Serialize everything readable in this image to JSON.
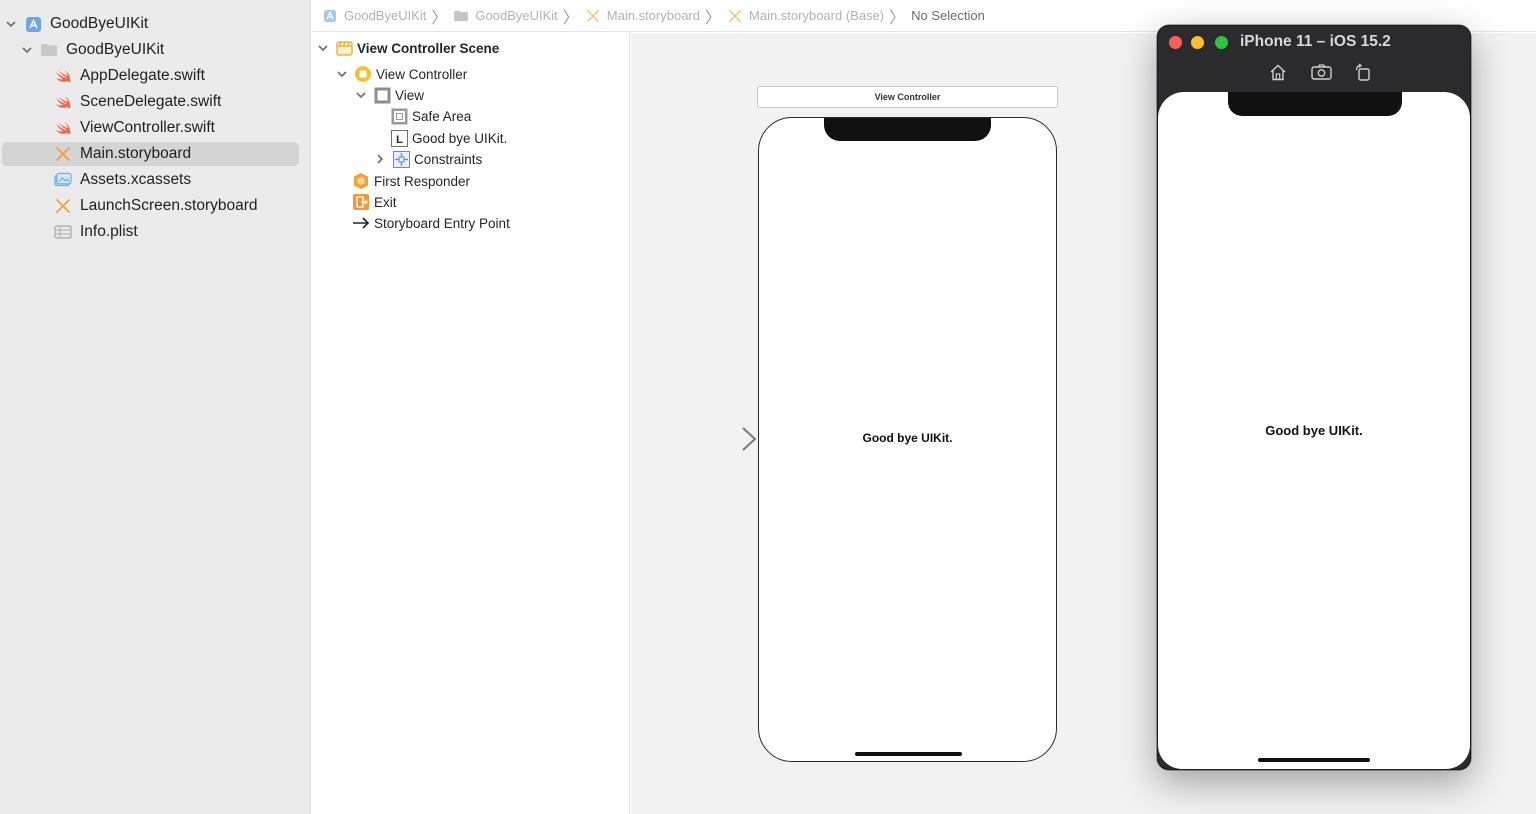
{
  "navigator": {
    "items": [
      {
        "label": "GoodByeUIKit",
        "icon": "xcode-project-icon",
        "expanded": true
      },
      {
        "label": "GoodByeUIKit",
        "icon": "folder-icon",
        "expanded": true
      },
      {
        "label": "AppDelegate.swift",
        "icon": "swift-file-icon"
      },
      {
        "label": "SceneDelegate.swift",
        "icon": "swift-file-icon"
      },
      {
        "label": "ViewController.swift",
        "icon": "swift-file-icon"
      },
      {
        "label": "Main.storyboard",
        "icon": "storyboard-file-icon",
        "selected": true
      },
      {
        "label": "Assets.xcassets",
        "icon": "asset-catalog-icon"
      },
      {
        "label": "LaunchScreen.storyboard",
        "icon": "storyboard-file-icon"
      },
      {
        "label": "Info.plist",
        "icon": "plist-file-icon"
      }
    ]
  },
  "jumpbar": {
    "crumbs": [
      {
        "label": "GoodByeUIKit",
        "icon": "xcode-project-icon"
      },
      {
        "label": "GoodByeUIKit",
        "icon": "folder-icon"
      },
      {
        "label": "Main.storyboard",
        "icon": "storyboard-file-icon"
      },
      {
        "label": "Main.storyboard (Base)",
        "icon": "storyboard-file-icon"
      },
      {
        "label": "No Selection",
        "icon": ""
      }
    ]
  },
  "outline": {
    "items": [
      {
        "label": "View Controller Scene",
        "icon": "scene-icon"
      },
      {
        "label": "View Controller",
        "icon": "view-controller-icon"
      },
      {
        "label": "View",
        "icon": "view-icon"
      },
      {
        "label": "Safe Area",
        "icon": "safe-area-icon"
      },
      {
        "label": "Good bye UIKit.",
        "icon": "label-icon",
        "glyph": "L"
      },
      {
        "label": "Constraints",
        "icon": "constraints-icon"
      },
      {
        "label": "First Responder",
        "icon": "first-responder-icon"
      },
      {
        "label": "Exit",
        "icon": "exit-icon"
      },
      {
        "label": "Storyboard Entry Point",
        "icon": "entry-point-arrow-icon"
      }
    ]
  },
  "canvas": {
    "scene_title": "View Controller",
    "label_text": "Good bye UIKit."
  },
  "simulator": {
    "title": "iPhone 11 – iOS 15.2",
    "tools": [
      "home-icon",
      "screenshot-icon",
      "rotate-icon"
    ],
    "label_text": "Good bye UIKit."
  },
  "colors": {
    "navigator_bg": "#ebebeb",
    "selection_bg": "#d4d4d4",
    "canvas_bg": "#f2f2f2",
    "storyboard_accent": "#f0a23a",
    "swift_accent": "#f05138",
    "simulator_chrome": "#2b2b2d",
    "traffic_red": "#fe5f57",
    "traffic_yellow": "#febc2e",
    "traffic_green": "#28c840"
  }
}
